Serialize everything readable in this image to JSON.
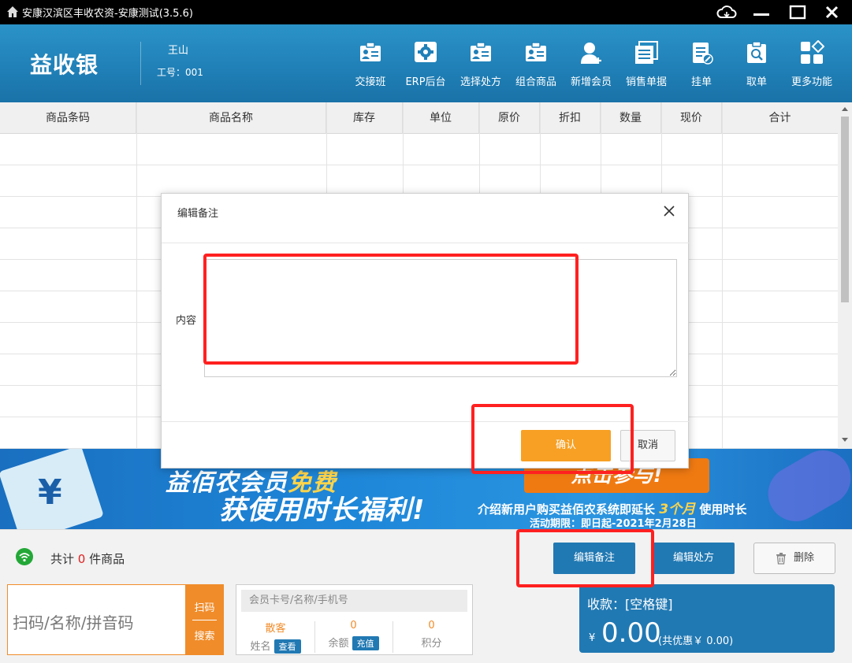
{
  "window": {
    "title": "安康汉滨区丰收农资-安康测试(3.5.6)"
  },
  "header": {
    "logo": "益收银",
    "user_name": "王山",
    "employee_label": "工号：",
    "employee_id": "001",
    "tools": [
      {
        "label": "交接班",
        "icon": "id-card-icon"
      },
      {
        "label": "ERP后台",
        "icon": "erp-gear-icon"
      },
      {
        "label": "选择处方",
        "icon": "id-card-icon"
      },
      {
        "label": "组合商品",
        "icon": "id-card-icon"
      },
      {
        "label": "新增会员",
        "icon": "add-user-icon"
      },
      {
        "label": "销售单据",
        "icon": "document-stack-icon"
      },
      {
        "label": "挂单",
        "icon": "clipboard-edit-icon"
      },
      {
        "label": "取单",
        "icon": "clipboard-search-icon"
      },
      {
        "label": "更多功能",
        "icon": "grid-more-icon"
      }
    ]
  },
  "table": {
    "columns": [
      "商品条码",
      "商品名称",
      "库存",
      "单位",
      "原价",
      "折扣",
      "数量",
      "现价",
      "合计"
    ]
  },
  "banner": {
    "line1_main": "益佰农会员",
    "line1_highlight": "免费",
    "line2": "获使用时长福利!",
    "cta": "点击参与!",
    "promo_prefix": "介绍新用户购买益佰农系统即延长",
    "promo_highlight": "3个月",
    "promo_suffix": "使用时长",
    "period": "活动期限：即日起-2021年2月28日"
  },
  "actionbar": {
    "total_prefix": "共计",
    "total_count": "0",
    "total_suffix": "件商品",
    "edit_remark": "编辑备注",
    "edit_prescription": "编辑处方",
    "delete": "删除"
  },
  "bottom": {
    "scan_placeholder": "扫码/名称/拼音码",
    "scan_btn": "扫码",
    "search_btn": "搜索",
    "member_placeholder": "会员卡号/名称/手机号",
    "member_name_value": "散客",
    "member_name_label": "姓名",
    "member_view": "查看",
    "balance_value": "0",
    "balance_label": "余额",
    "recharge": "充值",
    "points_value": "0",
    "points_label": "积分",
    "pay_label": "收款：[空格键]",
    "currency": "¥",
    "amount": "0.00",
    "discount_text": "(共优惠￥ 0.00)"
  },
  "dialog": {
    "title": "编辑备注",
    "content_label": "内容",
    "content_value": "",
    "confirm": "确认",
    "cancel": "取消"
  }
}
